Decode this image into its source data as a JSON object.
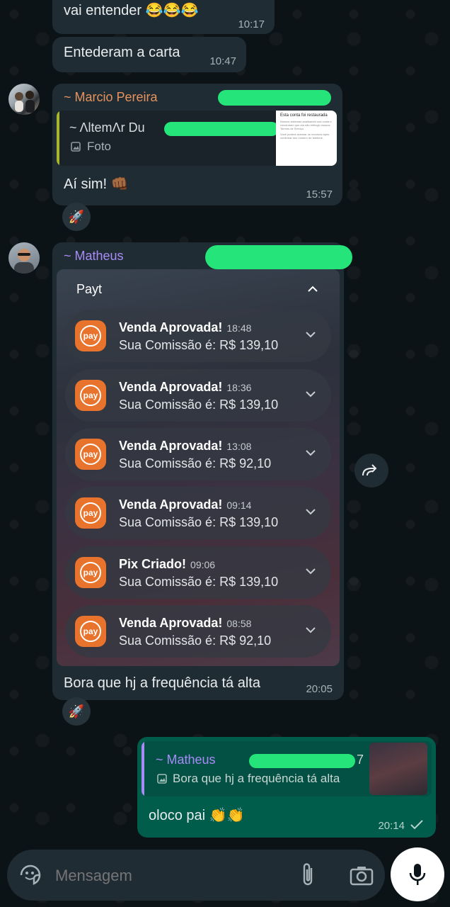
{
  "messages": {
    "m1": {
      "text": "vai entender 😂😂😂",
      "time": "10:17"
    },
    "m2": {
      "text": "Entederam a carta",
      "time": "10:47"
    },
    "m3": {
      "sender": "~ Marcio Pereira",
      "quote_sender": "~ ΛltemΛr Du",
      "quote_kind": "Foto",
      "thumb_title": "Esta conta foi restaurada",
      "thumb_lines": [
        "Nossos sistemas analisaram sua conta e concluíram que ela não infringiu nossos Termos de Serviço.",
        "Você poderá acessar os recursos após confirmar seu número de telefone."
      ],
      "text": "Aí sim! 👊🏾",
      "time": "15:57",
      "reaction": "🚀"
    },
    "m4": {
      "sender": "~ Matheus",
      "card_title": "Payt",
      "text": "Bora que hj a frequência tá alta",
      "time": "20:05",
      "reaction": "🚀"
    },
    "m5": {
      "quote_sender": "~ Matheus",
      "quote_number_tail": "7",
      "quote_text": "Bora que hj a frequência tá alta",
      "text": "oloco pai 👏👏",
      "time": "20:14"
    }
  },
  "notifications": [
    {
      "icon": "payt",
      "title": "Venda Aprovada!",
      "time": "18:48",
      "body": "Sua Comissão é: R$ 139,10"
    },
    {
      "icon": "payt",
      "title": "Venda Aprovada!",
      "time": "18:36",
      "body": "Sua Comissão é: R$ 139,10"
    },
    {
      "icon": "payt",
      "title": "Venda Aprovada!",
      "time": "13:08",
      "body": "Sua Comissão é: R$ 92,10"
    },
    {
      "icon": "payt",
      "title": "Venda Aprovada!",
      "time": "09:14",
      "body": "Sua Comissão é: R$ 139,10"
    },
    {
      "icon": "payt",
      "title": "Pix Criado!",
      "time": "09:06",
      "body": "Sua Comissão é: R$ 139,10"
    },
    {
      "icon": "payt",
      "title": "Venda Aprovada!",
      "time": "08:58",
      "body": "Sua Comissão é: R$ 92,10"
    }
  ],
  "composer": {
    "placeholder": "Mensagem"
  },
  "colors": {
    "incoming_bubble": "#202c33",
    "outgoing_bubble": "#005c4b",
    "marcio_name": "#e6925e",
    "matheus_name": "#a88bf7",
    "payt_orange": "#e8732c",
    "redaction": "#25e57a"
  }
}
